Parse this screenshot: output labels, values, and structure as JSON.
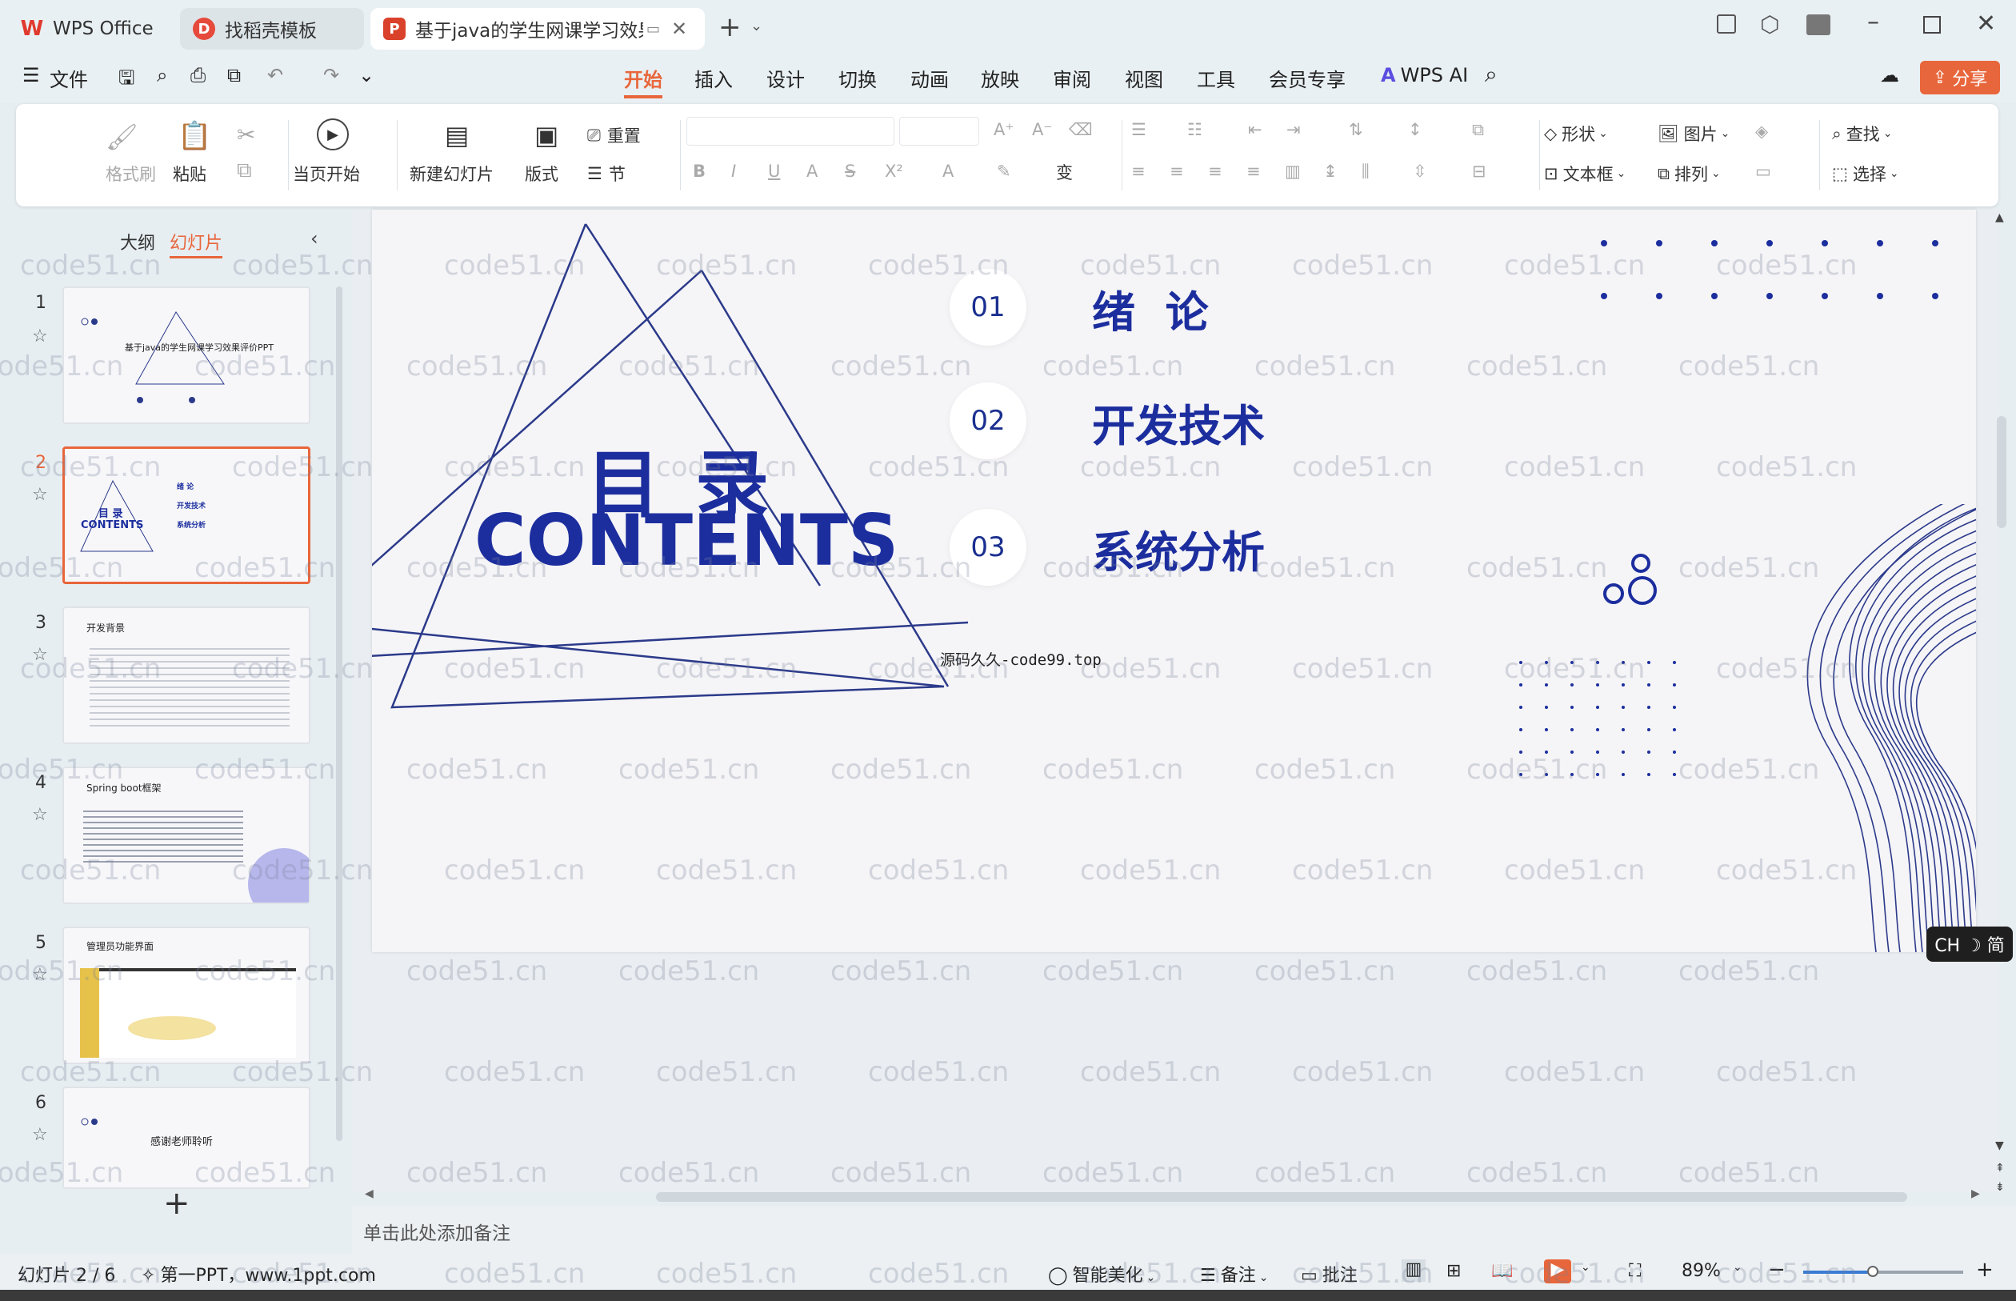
{
  "tabs": [
    {
      "label": "WPS Office"
    },
    {
      "label": "找稻壳模板"
    },
    {
      "label": "基于java的学生网课学习效果"
    }
  ],
  "menu": {
    "file": "文件",
    "items": [
      "开始",
      "插入",
      "设计",
      "切换",
      "动画",
      "放映",
      "审阅",
      "视图",
      "工具",
      "会员专享"
    ],
    "active": "开始",
    "ai": "WPS AI",
    "share": "分享"
  },
  "ribbon": {
    "format_painter": "格式刷",
    "paste": "粘贴",
    "start_from_current": "当页开始",
    "new_slide": "新建幻灯片",
    "layout": "版式",
    "reset": "重置",
    "section": "节",
    "shape": "形状",
    "picture": "图片",
    "textbox": "文本框",
    "arrange": "排列",
    "find": "查找",
    "select": "选择"
  },
  "panel": {
    "outline": "大纲",
    "slides": "幻灯片",
    "thumbs": [
      {
        "num": "1",
        "title": "基于java的学生网课学习效果评价PPT"
      },
      {
        "num": "2",
        "title": "目 录",
        "subtitle": "CONTENTS",
        "items": [
          "绪 论",
          "开发技术",
          "系统分析"
        ]
      },
      {
        "num": "3",
        "title": "开发背景"
      },
      {
        "num": "4",
        "title": "Spring boot框架"
      },
      {
        "num": "5",
        "title": "管理员功能界面"
      },
      {
        "num": "6",
        "title": "感谢老师聆听"
      }
    ]
  },
  "slide": {
    "title": "目 录",
    "subtitle": "CONTENTS",
    "items": [
      {
        "num": "01",
        "label": "绪  论"
      },
      {
        "num": "02",
        "label": "开发技术"
      },
      {
        "num": "03",
        "label": "系统分析"
      }
    ],
    "source": "源码久久-code99.top"
  },
  "ime": "CH ☽ 简",
  "notes_placeholder": "单击此处添加备注",
  "status": {
    "slide_counter": "幻灯片 2 / 6",
    "theme": "第一PPT，www.1ppt.com",
    "beautify": "智能美化",
    "notes": "备注",
    "comments": "批注",
    "zoom": "89%"
  },
  "watermark": "code51.cn",
  "colors": {
    "accent": "#e8663b",
    "slide_blue": "#1c2e9e",
    "line_blue": "#2b3a8a"
  }
}
